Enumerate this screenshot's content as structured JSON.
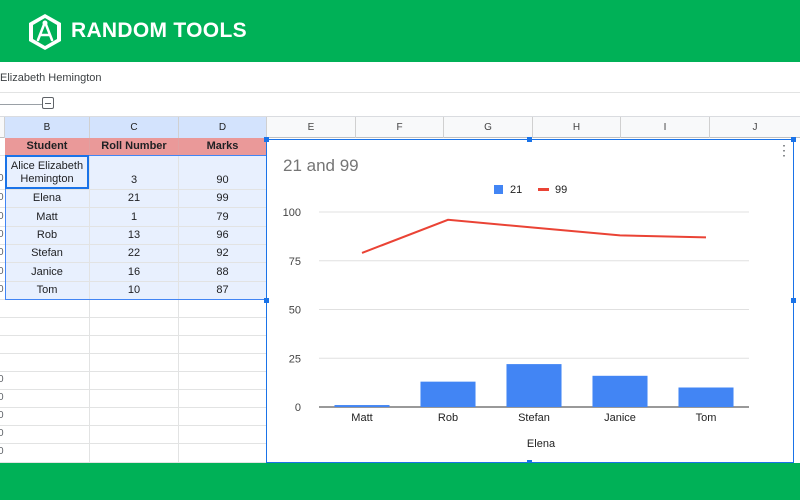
{
  "brand": {
    "name": "RANDOM TOOLS",
    "color": "#00b157"
  },
  "formula_bar": {
    "value": "Elizabeth Hemington"
  },
  "columns": [
    "B",
    "C",
    "D",
    "E",
    "F",
    "G",
    "H",
    "I",
    "J"
  ],
  "table": {
    "headers": [
      "Student",
      "Roll Number",
      "Marks"
    ],
    "rows": [
      {
        "student": "Alice Elizabeth Hemington",
        "roll": "3",
        "marks": "90"
      },
      {
        "student": "Elena",
        "roll": "21",
        "marks": "99"
      },
      {
        "student": "Matt",
        "roll": "1",
        "marks": "79"
      },
      {
        "student": "Rob",
        "roll": "13",
        "marks": "96"
      },
      {
        "student": "Stefan",
        "roll": "22",
        "marks": "92"
      },
      {
        "student": "Janice",
        "roll": "16",
        "marks": "88"
      },
      {
        "student": "Tom",
        "roll": "10",
        "marks": "87"
      }
    ],
    "row_number_glyph": "0"
  },
  "chart_data": {
    "type": "bar",
    "title": "21 and 99",
    "xlabel": "Elena",
    "categories": [
      "Matt",
      "Rob",
      "Stefan",
      "Janice",
      "Tom"
    ],
    "series": [
      {
        "name": "21",
        "type": "bar",
        "color": "#4285f4",
        "values": [
          1,
          13,
          22,
          16,
          10
        ]
      },
      {
        "name": "99",
        "type": "line",
        "color": "#ea4335",
        "values": [
          79,
          96,
          92,
          88,
          87
        ]
      }
    ],
    "yticks": [
      "0",
      "25",
      "50",
      "75",
      "100"
    ],
    "ylim": [
      0,
      100
    ],
    "legend": "top",
    "grid": true
  }
}
